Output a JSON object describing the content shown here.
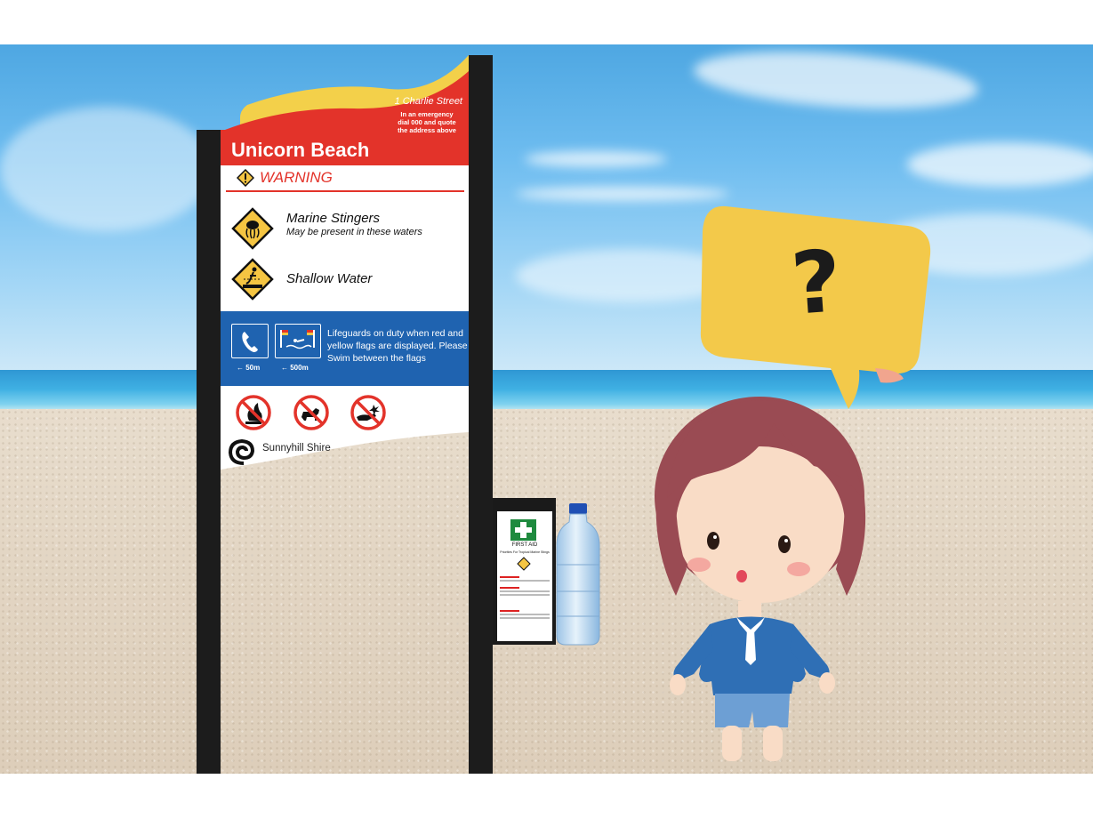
{
  "sign": {
    "title": "Unicorn Beach",
    "address": "1 Charlie Street",
    "emergency": "In an emergency\ndial 000 and quote\nthe address above",
    "warning": "WARNING",
    "hazards": [
      {
        "title": "Marine Stingers",
        "subtitle": "May be present in these waters",
        "icon": "jellyfish-icon"
      },
      {
        "title": "Shallow Water",
        "subtitle": "",
        "icon": "diving-person-icon"
      }
    ],
    "phone_distance": "← 50m",
    "lifeguard_distance": "← 500m",
    "lifeguard_text": "Lifeguards on duty when red and yellow flags are displayed. Please Swim between the flags",
    "prohibitions": [
      "no-fire-icon",
      "no-dogs-icon",
      "no-feeding-icon"
    ],
    "council": "Sunnyhill Shire"
  },
  "first_aid": {
    "label": "FIRST AID",
    "subtitle": "Priorities For Tropical Marine Stings"
  },
  "bubble": {
    "symbol": "?"
  },
  "colors": {
    "red": "#e3332a",
    "blue": "#1f63b0",
    "yellow": "#f5c542",
    "sand": "#e3d6c4"
  }
}
